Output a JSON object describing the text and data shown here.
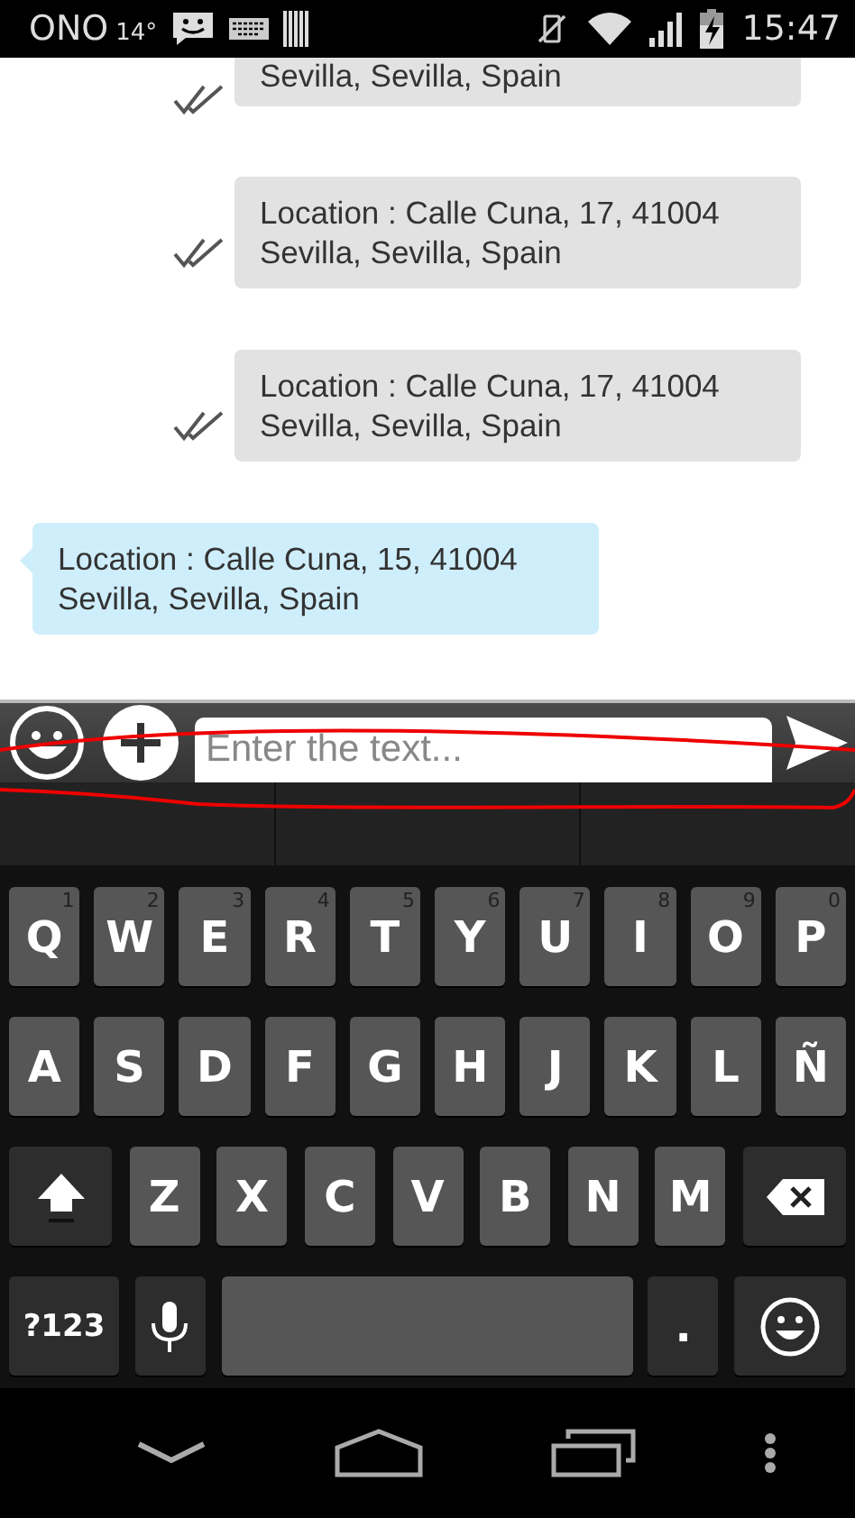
{
  "status_bar": {
    "carrier": "ONO",
    "temperature": "14°",
    "time": "15:47"
  },
  "messages": [
    {
      "kind": "outgoing",
      "text": "Sevilla, Sevilla, Spain"
    },
    {
      "kind": "outgoing",
      "text": "Location : Calle Cuna, 17, 41004 Sevilla, Sevilla, Spain"
    },
    {
      "kind": "outgoing",
      "text": "Location : Calle Cuna, 17, 41004 Sevilla, Sevilla, Spain"
    },
    {
      "kind": "incoming",
      "text": "Location : Calle Cuna, 15, 41004 Sevilla, Sevilla, Spain"
    }
  ],
  "composer": {
    "placeholder": "Enter the text..."
  },
  "keyboard": {
    "rows": [
      [
        {
          "kind": "letter",
          "label": "Q",
          "hint": "1"
        },
        {
          "kind": "letter",
          "label": "W",
          "hint": "2"
        },
        {
          "kind": "letter",
          "label": "E",
          "hint": "3"
        },
        {
          "kind": "letter",
          "label": "R",
          "hint": "4"
        },
        {
          "kind": "letter",
          "label": "T",
          "hint": "5"
        },
        {
          "kind": "letter",
          "label": "Y",
          "hint": "6"
        },
        {
          "kind": "letter",
          "label": "U",
          "hint": "7"
        },
        {
          "kind": "letter",
          "label": "I",
          "hint": "8"
        },
        {
          "kind": "letter",
          "label": "O",
          "hint": "9"
        },
        {
          "kind": "letter",
          "label": "P",
          "hint": "0"
        }
      ],
      [
        {
          "kind": "letter",
          "label": "A"
        },
        {
          "kind": "letter",
          "label": "S"
        },
        {
          "kind": "letter",
          "label": "D"
        },
        {
          "kind": "letter",
          "label": "F"
        },
        {
          "kind": "letter",
          "label": "G"
        },
        {
          "kind": "letter",
          "label": "H"
        },
        {
          "kind": "letter",
          "label": "J"
        },
        {
          "kind": "letter",
          "label": "K"
        },
        {
          "kind": "letter",
          "label": "L"
        },
        {
          "kind": "letter",
          "label": "Ñ"
        }
      ],
      [
        {
          "kind": "shift"
        },
        {
          "kind": "letter",
          "label": "Z"
        },
        {
          "kind": "letter",
          "label": "X"
        },
        {
          "kind": "letter",
          "label": "C"
        },
        {
          "kind": "letter",
          "label": "V"
        },
        {
          "kind": "letter",
          "label": "B"
        },
        {
          "kind": "letter",
          "label": "N"
        },
        {
          "kind": "letter",
          "label": "M"
        },
        {
          "kind": "backspace"
        }
      ],
      [
        {
          "kind": "symbols",
          "label": "?123"
        },
        {
          "kind": "mic"
        },
        {
          "kind": "space"
        },
        {
          "kind": "period",
          "label": "."
        },
        {
          "kind": "emoji"
        }
      ]
    ]
  }
}
